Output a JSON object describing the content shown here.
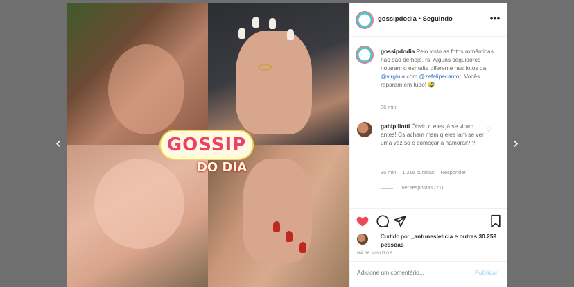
{
  "nav": {
    "prev_icon": "chevron-left-icon",
    "next_icon": "chevron-right-icon",
    "prev_glyph": "‹",
    "next_glyph": "›"
  },
  "photo": {
    "logo_word": "GOSSIP",
    "logo_sub": "DO DIA",
    "colors": {
      "pink": "#ef3f6a",
      "yellow": "#f7d64a",
      "cream": "#fffbe0"
    }
  },
  "post": {
    "header": {
      "username": "gossipdodia",
      "separator": " • ",
      "follow_label": "Seguindo",
      "more_glyph": "•••"
    },
    "caption": {
      "username": "gossipdodia",
      "text_before": " Pelo visto as fotos românticas não são de hoje, rs! Alguns seguidores notaram o esmalte diferente nas fotos da ",
      "mention1": "@virginia",
      "text_mid": " com ",
      "mention2": "@zefelipecantor",
      "text_after": ". Vocês reparam em tudo! 🤣",
      "time": "36 min"
    },
    "comment": {
      "username": "gabipillotti",
      "text": " Óbvio q eles já se viram antes! Cs acham msm q eles iam se ver uma vez só e começar a namorar?!?!",
      "heart_glyph": "♡",
      "time": "35 min",
      "likes": "1.216 curtidas",
      "reply_label": "Responder",
      "view_replies": "Ver respostas (21)"
    },
    "likes_line": {
      "prefix": "Curtido por ",
      "user": "_antunesleticia",
      "middle": " e ",
      "others": "outras 30.259 pessoas"
    },
    "timestamp": "HÁ 36 MINUTOS",
    "add_comment": {
      "placeholder": "Adicione um comentário...",
      "button": "Publicar"
    },
    "colors": {
      "like_red": "#ed4956",
      "link_blue": "#2a74c0",
      "muted": "#8e8e8e"
    }
  }
}
